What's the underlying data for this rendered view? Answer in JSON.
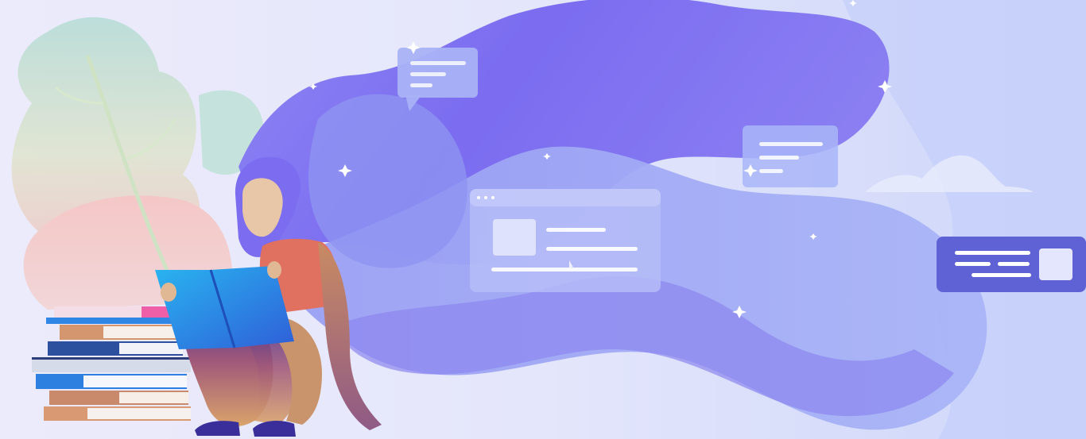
{
  "illustration": {
    "subject": "person-reading-book-with-flowing-hair",
    "icons": [
      "chat-bubble-icon",
      "browser-window-icon",
      "message-card-icon",
      "cloud-icon",
      "sparkle-icon",
      "book-stack-icon",
      "plant-icon"
    ]
  },
  "colors": {
    "background": "#e7e9fb",
    "hair_primary": "#7f6ef0",
    "hair_light": "#9da7f3",
    "panel_light": "#a9b3f6",
    "card_dark": "#5f62d4",
    "skin": "#e8c7a8",
    "shirt": "#e0705f",
    "book_blue": "#2d7fe0"
  }
}
